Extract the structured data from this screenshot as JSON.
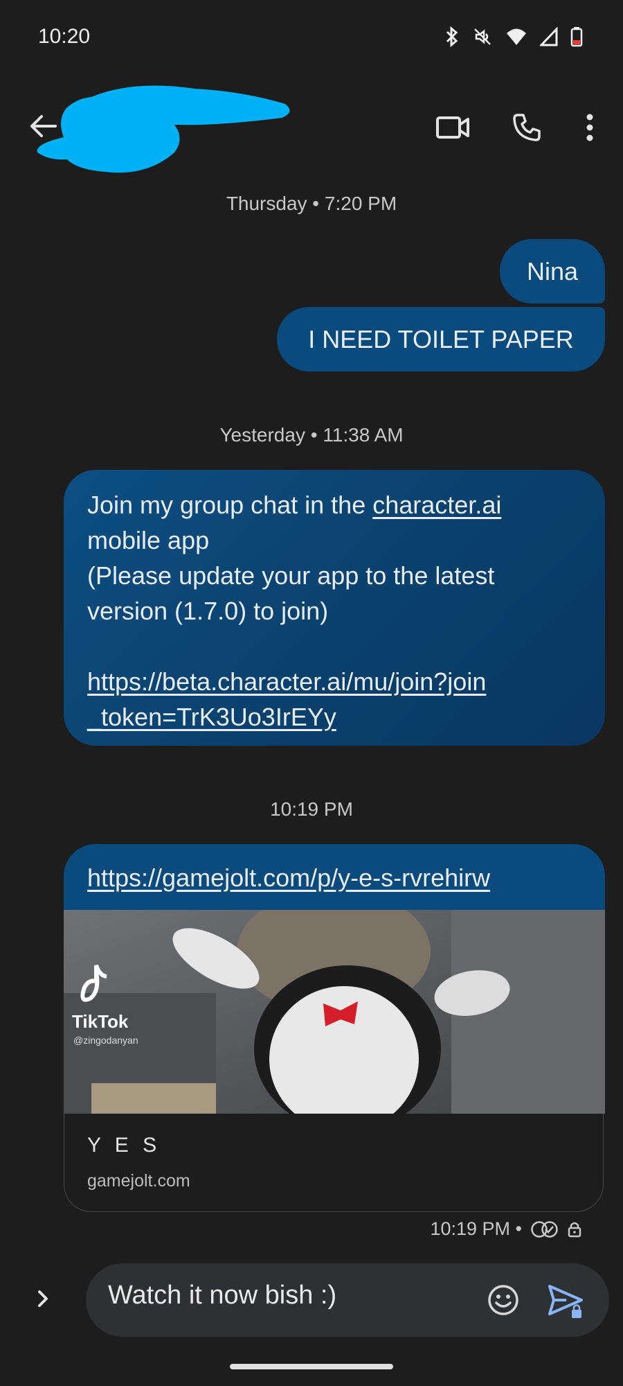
{
  "status": {
    "time": "10:20",
    "icons": [
      "bluetooth-icon",
      "mute-icon",
      "wifi-icon",
      "signal-icon",
      "battery-icon"
    ]
  },
  "header": {
    "contact_name_redacted": true,
    "actions": [
      "video-call-icon",
      "phone-icon",
      "more-vert-icon"
    ]
  },
  "conversation": {
    "ts1": "Thursday • 7:20 PM",
    "out1": "Nina",
    "out2": "I NEED TOILET PAPER",
    "ts2": "Yesterday • 11:38 AM",
    "in1": {
      "l1_pre": "Join my group chat in the ",
      "l1_link": "character.ai",
      "l2": "mobile app",
      "l3": "(Please update your app to the latest",
      "l4": "version (1.7.0) to join)",
      "url1": "https://beta.character.ai/mu/join?join",
      "url2": "_token=TrK3Uo3IrEYy"
    },
    "ts3": "10:19 PM",
    "in2": {
      "url": "https://gamejolt.com/p/y-e-s-rvrehirw",
      "preview_watermark": "TikTok",
      "preview_handle": "@zingodanyan",
      "card_title": "Y E S",
      "card_site": "gamejolt.com"
    },
    "sent_meta": "10:19 PM •"
  },
  "compose": {
    "value": "Watch it now bish :)",
    "placeholder": ""
  },
  "colors": {
    "background": "#1c1d1c",
    "bubble": "#0b4a7c",
    "compose": "#2e3133",
    "redaction": "#00b2f5"
  }
}
